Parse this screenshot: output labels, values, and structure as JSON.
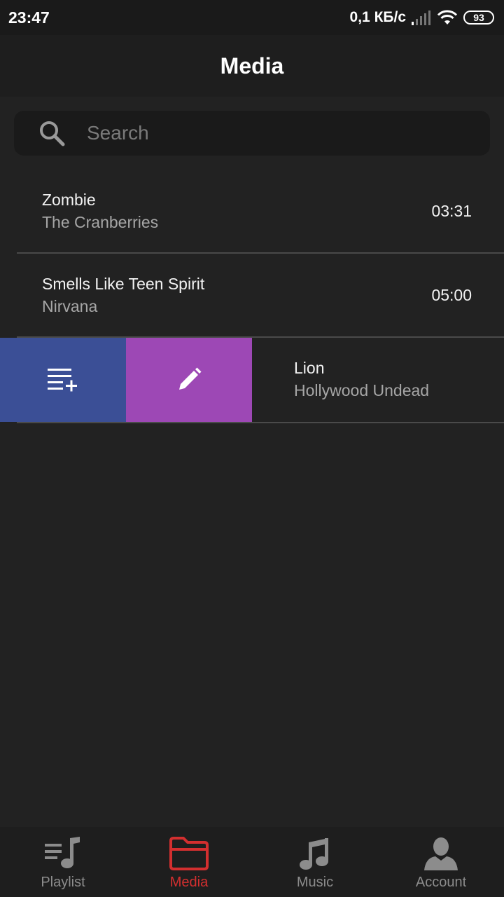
{
  "status_bar": {
    "time": "23:47",
    "network_speed": "0,1 КБ/с",
    "battery": "93"
  },
  "app_bar": {
    "title": "Media"
  },
  "search": {
    "placeholder": "Search",
    "value": ""
  },
  "tracks": [
    {
      "title": "Zombie",
      "artist": "The Cranberries",
      "duration": "03:31"
    },
    {
      "title": "Smells Like Teen Spirit",
      "artist": "Nirvana",
      "duration": "05:00"
    },
    {
      "title": "Lion",
      "artist": "Hollywood Undead",
      "duration": ""
    }
  ],
  "swipe_actions": {
    "add_icon": "playlist-add-icon",
    "edit_icon": "pencil-icon",
    "add_color": "#3b4f96",
    "edit_color": "#9d48b5"
  },
  "bottom_nav": {
    "items": [
      {
        "label": "Playlist",
        "icon": "playlist-music-icon",
        "active": false
      },
      {
        "label": "Media",
        "icon": "folder-icon",
        "active": true
      },
      {
        "label": "Music",
        "icon": "music-note-icon",
        "active": false
      },
      {
        "label": "Account",
        "icon": "account-icon",
        "active": false
      }
    ],
    "active_color": "#d32f2f",
    "inactive_color": "#8c8c8c"
  }
}
